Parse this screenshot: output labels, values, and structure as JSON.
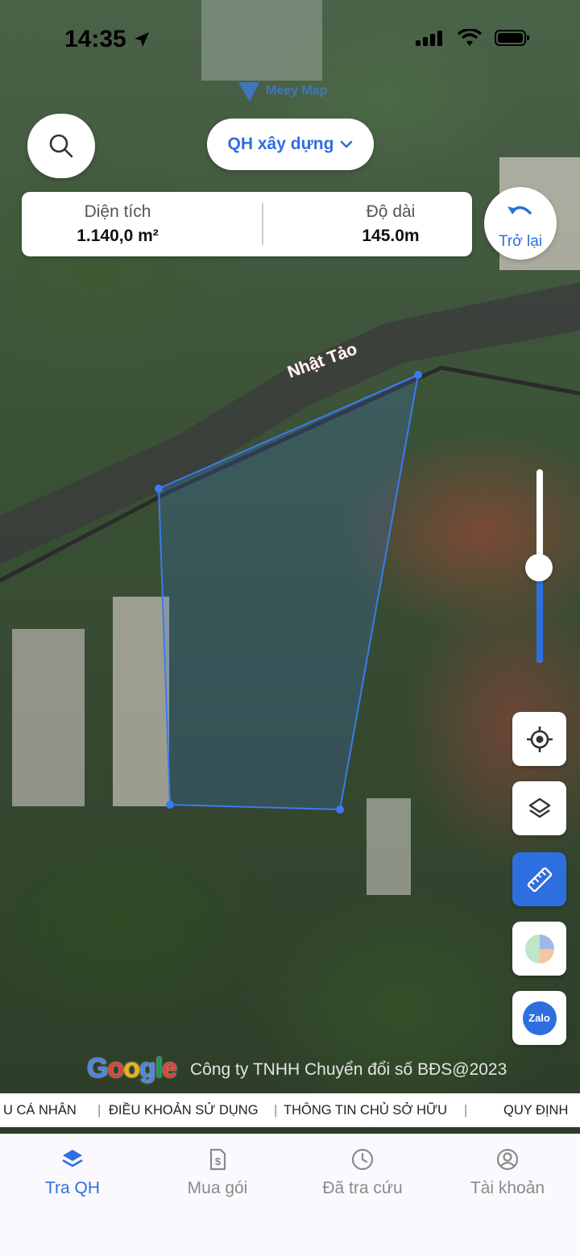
{
  "status_bar": {
    "time": "14:35"
  },
  "watermark": {
    "text": "Meey Map"
  },
  "search": {
    "icon": "search-icon"
  },
  "layer_selector": {
    "label": "QH xây dựng"
  },
  "measurement": {
    "area_label": "Diện tích",
    "area_value": "1.140,0  m²",
    "length_label": "Độ dài",
    "length_value": "145.0m"
  },
  "undo": {
    "label": "Trở lại"
  },
  "map": {
    "road_name": "Nhật Tảo",
    "zoom_level_fraction": 0.49,
    "attribution_logo": "Google",
    "copyright": "Công ty TNHH Chuyển đổi số BĐS@2023",
    "parcel_color": "#3b7bf0"
  },
  "tools": {
    "locate": "locate-icon",
    "layers": "layers-icon",
    "ruler": "ruler-icon",
    "chart": "chart-icon",
    "zalo": "Zalo"
  },
  "footer_links": [
    "U CÁ NHÂN",
    "ĐIỀU KHOẢN SỬ DỤNG",
    "THÔNG TIN CHỦ SỞ HỮU",
    "QUY ĐỊNH"
  ],
  "tabs": [
    {
      "label": "Tra QH",
      "icon": "layers-icon",
      "active": true
    },
    {
      "label": "Mua gói",
      "icon": "invoice-icon",
      "active": false
    },
    {
      "label": "Đã tra cứu",
      "icon": "clock-icon",
      "active": false
    },
    {
      "label": "Tài khoản",
      "icon": "user-icon",
      "active": false
    }
  ],
  "colors": {
    "accent": "#2e6fe0"
  }
}
